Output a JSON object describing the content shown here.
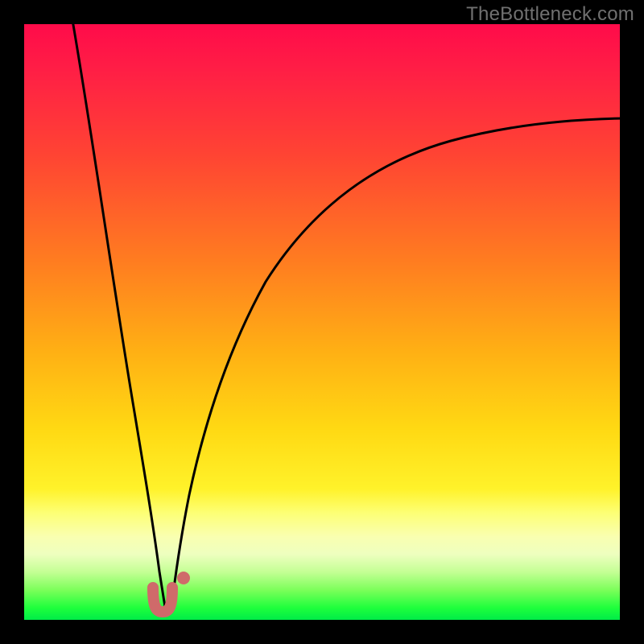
{
  "watermark": {
    "text": "TheBottleneck.com"
  },
  "colors": {
    "frame": "#000000",
    "curve": "#000000",
    "marker": "#cf6a6a",
    "gradient_top": "#ff0b4a",
    "gradient_bottom": "#00ec48"
  },
  "chart_data": {
    "type": "line",
    "title": "",
    "xlabel": "",
    "ylabel": "",
    "xlim": [
      0,
      100
    ],
    "ylim": [
      0,
      100
    ],
    "grid": false,
    "note": "Bottleneck-style V curve. Values estimated from pixel positions; no axes or tick labels are shown in the image.",
    "minimum": {
      "x": 23,
      "y": 1
    },
    "series": [
      {
        "name": "left-branch",
        "x": [
          8,
          10,
          12,
          14,
          16,
          18,
          20,
          22,
          23
        ],
        "y": [
          100,
          85,
          70,
          56,
          43,
          31,
          19,
          8,
          1
        ]
      },
      {
        "name": "right-branch",
        "x": [
          23,
          24,
          26,
          28,
          32,
          38,
          46,
          56,
          68,
          82,
          100
        ],
        "y": [
          1,
          5,
          14,
          25,
          40,
          52,
          62,
          70,
          76,
          80,
          84
        ]
      }
    ],
    "markers": [
      {
        "shape": "u",
        "x": 22.3,
        "y": 2.7,
        "label": "min-region-left"
      },
      {
        "shape": "dot",
        "x": 26.0,
        "y": 6.5,
        "label": "near-min-right"
      }
    ]
  }
}
